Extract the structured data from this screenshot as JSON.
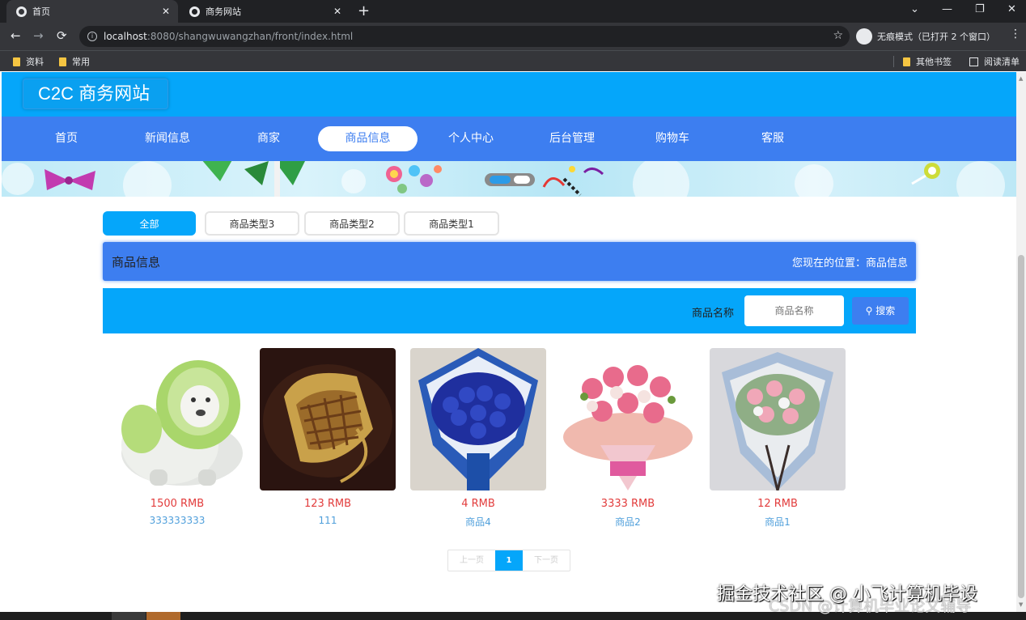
{
  "browser": {
    "tabs": [
      {
        "title": "首页",
        "active": true
      },
      {
        "title": "商务网站",
        "active": false
      }
    ],
    "close_glyph": "✕",
    "new_tab_glyph": "+",
    "window_controls": {
      "minimize": "—",
      "restore": "❐",
      "close": "✕",
      "tab_list": "⌄"
    },
    "url_host": "localhost",
    "url_path": ":8080/shangwuwangzhan/front/index.html",
    "incognito_label": "无痕模式（已打开 2 个窗口）",
    "bookmarks": [
      "资料",
      "常用"
    ],
    "bookmarks_right": [
      "其他书签",
      "阅读清单"
    ]
  },
  "site": {
    "logo": "C2C 商务网站",
    "nav": [
      {
        "label": "首页",
        "active": false
      },
      {
        "label": "新闻信息",
        "active": false
      },
      {
        "label": "商家",
        "active": false
      },
      {
        "label": "商品信息",
        "active": true
      },
      {
        "label": "个人中心",
        "active": false
      },
      {
        "label": "后台管理",
        "active": false
      },
      {
        "label": "购物车",
        "active": false
      },
      {
        "label": "客服",
        "active": false
      }
    ]
  },
  "filters": [
    {
      "label": "全部",
      "active": true
    },
    {
      "label": "商品类型3",
      "active": false
    },
    {
      "label": "商品类型2",
      "active": false
    },
    {
      "label": "商品类型1",
      "active": false
    }
  ],
  "title_bar": {
    "title": "商品信息",
    "location_label": "您现在的位置：商品信息"
  },
  "search": {
    "label": "商品名称",
    "placeholder": "商品名称",
    "button_label": "搜索"
  },
  "products": [
    {
      "price": "1500 RMB",
      "name": "333333333",
      "image": "cabbage-dog"
    },
    {
      "price": "123 RMB",
      "name": "111",
      "image": "bamboo-basket"
    },
    {
      "price": "4 RMB",
      "name": "商品4",
      "image": "blue-rose-bouquet"
    },
    {
      "price": "3333 RMB",
      "name": "商品2",
      "image": "pink-carnation-bouquet"
    },
    {
      "price": "12 RMB",
      "name": "商品1",
      "image": "pink-rose-bouquet"
    }
  ],
  "pagination": {
    "prev_label": "上一页",
    "current_page": "1",
    "next_label": "下一页"
  },
  "watermark": "掘金技术社区 @ 小飞计算机毕设",
  "watermark2": "CSDN @计算机毕业论文辅导",
  "colors": {
    "header_blue": "#05a6fa",
    "nav_blue": "#3d7ef0",
    "price_red": "#e23c3c",
    "name_blue": "#4f9fdb"
  }
}
